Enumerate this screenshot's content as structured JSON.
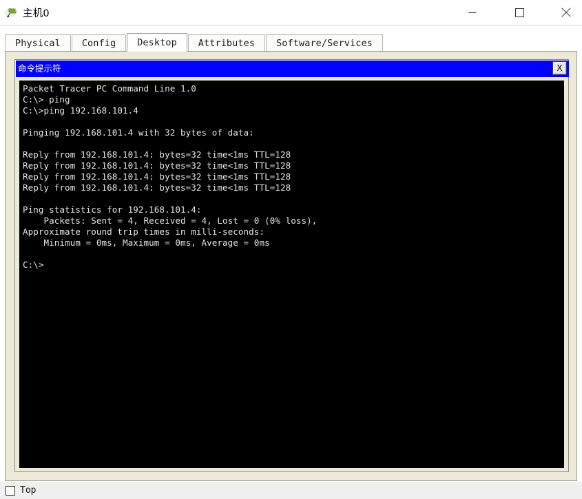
{
  "window": {
    "title": "主机0",
    "icon": "pc-device-icon",
    "controls": {
      "minimize": "minimize-icon",
      "maximize": "maximize-icon",
      "close": "close-icon"
    }
  },
  "tabs": [
    {
      "label": "Physical",
      "active": false
    },
    {
      "label": "Config",
      "active": false
    },
    {
      "label": "Desktop",
      "active": true
    },
    {
      "label": "Attributes",
      "active": false
    },
    {
      "label": "Software/Services",
      "active": false
    }
  ],
  "cmd_window": {
    "title": "命令提示符",
    "close_label": "X",
    "title_bar_color": "#0000ff",
    "terminal_bg": "#000000",
    "terminal_fg": "#e6e6e6",
    "terminal_lines": [
      "Packet Tracer PC Command Line 1.0",
      "C:\\> ping",
      "C:\\>ping 192.168.101.4",
      "",
      "Pinging 192.168.101.4 with 32 bytes of data:",
      "",
      "Reply from 192.168.101.4: bytes=32 time<1ms TTL=128",
      "Reply from 192.168.101.4: bytes=32 time<1ms TTL=128",
      "Reply from 192.168.101.4: bytes=32 time<1ms TTL=128",
      "Reply from 192.168.101.4: bytes=32 time<1ms TTL=128",
      "",
      "Ping statistics for 192.168.101.4:",
      "    Packets: Sent = 4, Received = 4, Lost = 0 (0% loss),",
      "Approximate round trip times in milli-seconds:",
      "    Minimum = 0ms, Maximum = 0ms, Average = 0ms",
      "",
      "C:\\>"
    ]
  },
  "bottom": {
    "top_checkbox_label": "Top",
    "top_checkbox_checked": false
  }
}
